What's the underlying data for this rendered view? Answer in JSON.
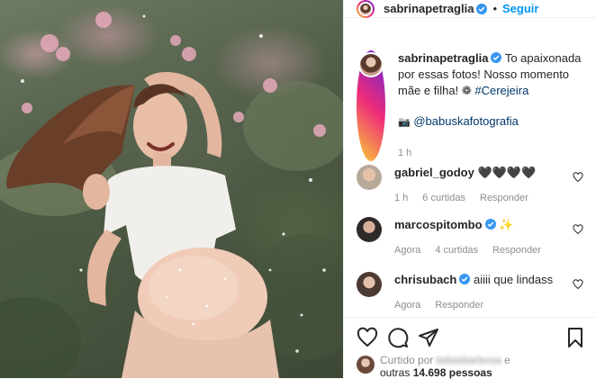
{
  "header": {
    "username": "sabrinapetraglia",
    "separator": "•",
    "follow_label": "Seguir"
  },
  "caption": {
    "username": "sabrinapetraglia",
    "text": "To apaixonada por essas fotos! Nosso momento mãe e filha!",
    "emoji": "❁",
    "hashtag": "#Cerejeira",
    "camera_glyph": "📷",
    "credit": "@babuskafotografia",
    "time": "1 h"
  },
  "comments": [
    {
      "username": "gabriel_godoy",
      "text": "🖤🖤🖤🖤",
      "time": "1 h",
      "likes": "6 curtidas",
      "reply": "Responder",
      "verified": false
    },
    {
      "username": "marcospitombo",
      "text": "✨",
      "time": "Agora",
      "likes": "4 curtidas",
      "reply": "Responder",
      "verified": true
    },
    {
      "username": "chrisubach",
      "text": "aiiii que lindass",
      "time": "Agora",
      "likes": "",
      "reply": "Responder",
      "verified": true
    }
  ],
  "likes": {
    "prefix": "Curtido por",
    "liker": "bdiasbarbosa",
    "conj": "e",
    "others": "outras",
    "count": "14.698",
    "suffix": "pessoas"
  },
  "colors": {
    "link": "#00376b",
    "follow": "#0095f6",
    "muted": "#8e8e8e",
    "verified": "#3897f0"
  }
}
